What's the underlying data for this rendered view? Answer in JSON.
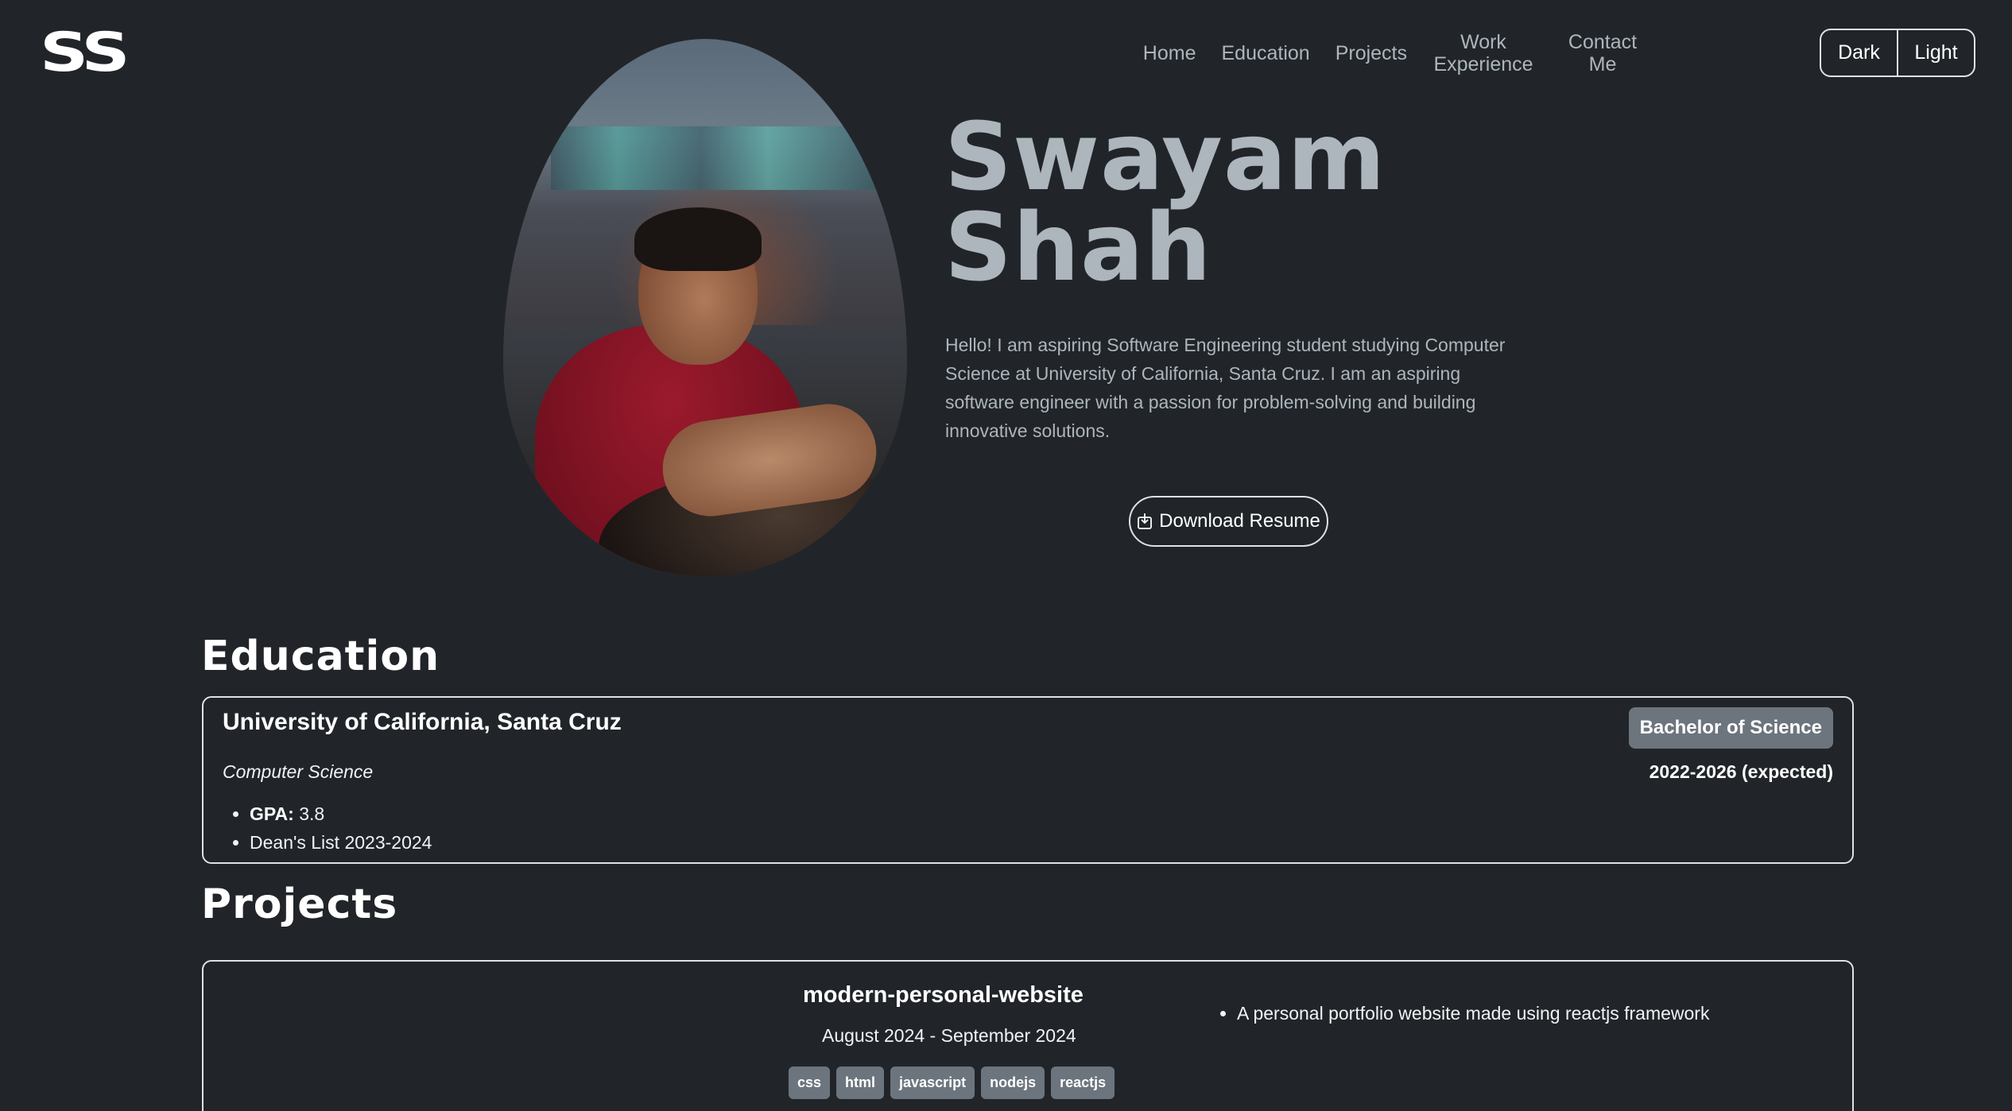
{
  "brand": {
    "logo_text": "SS"
  },
  "nav": {
    "items": [
      {
        "label": "Home"
      },
      {
        "label": "Education"
      },
      {
        "label": "Projects"
      },
      {
        "label": "Work Experience"
      },
      {
        "label": "Contact Me"
      }
    ]
  },
  "theme_toggle": {
    "dark_label": "Dark",
    "light_label": "Light"
  },
  "hero": {
    "name_line1": "Swayam",
    "name_line2": "Shah",
    "bio": "Hello! I am aspiring Software Engineering student studying Computer Science at University of California, Santa Cruz. I am an aspiring software engineer with a passion for problem-solving and building innovative solutions.",
    "resume_button": "Download Resume",
    "resume_icon": "download-icon"
  },
  "education": {
    "heading": "Education",
    "school": "University of California, Santa Cruz",
    "major": "Computer Science",
    "gpa_label": "GPA:",
    "gpa_value": "3.8",
    "honor": "Dean's List 2023-2024",
    "degree": "Bachelor of Science",
    "dates": "2022-2026 (expected)"
  },
  "projects": {
    "heading": "Projects",
    "items": [
      {
        "title": "modern-personal-website",
        "dates": "August 2024 - September 2024",
        "tags": [
          "css",
          "html",
          "javascript",
          "nodejs",
          "reactjs"
        ],
        "description": "A personal portfolio website made using reactjs framework"
      }
    ]
  },
  "colors": {
    "background": "#212529",
    "muted_text": "#adb5bd",
    "badge": "#6c757d",
    "border": "#dee2e6"
  }
}
